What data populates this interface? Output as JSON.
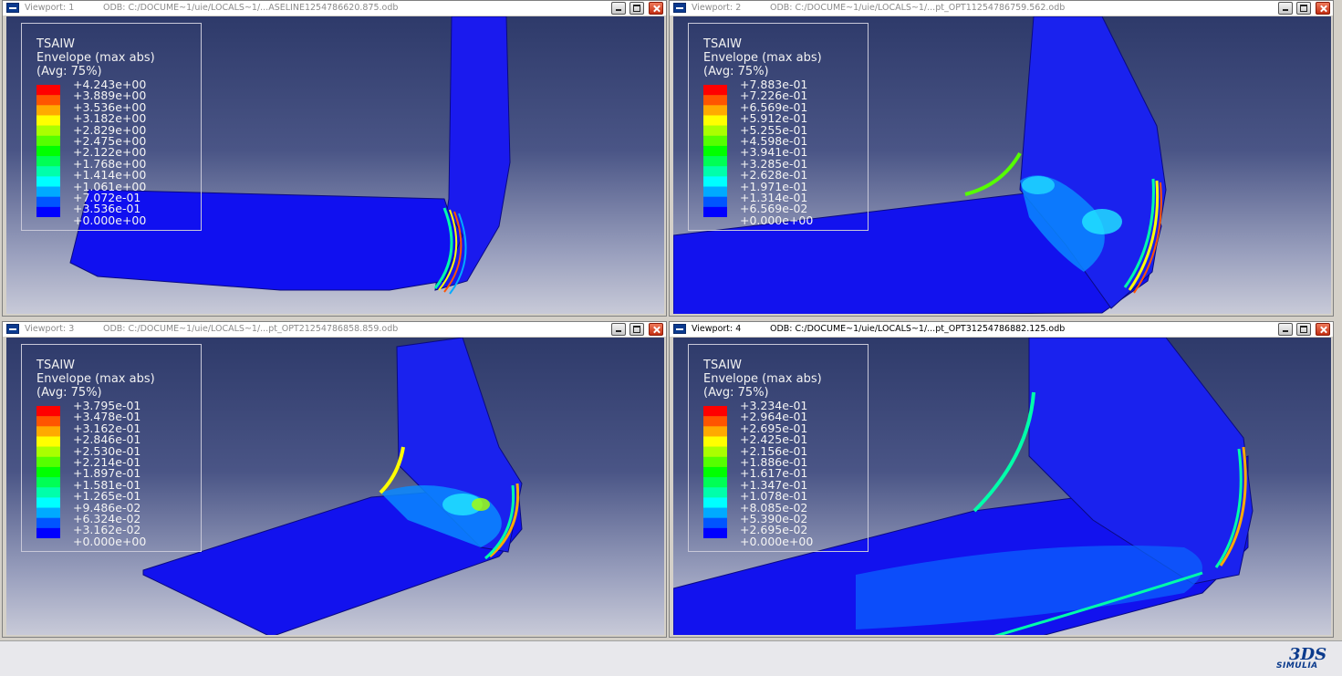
{
  "palette": [
    "#ff0000",
    "#ff5500",
    "#ffaa00",
    "#ffff00",
    "#aaff00",
    "#55ff00",
    "#00ff00",
    "#00ff55",
    "#00ffaa",
    "#00ffff",
    "#00aaff",
    "#0055ff",
    "#0000ff"
  ],
  "viewports": [
    {
      "name": "Viewport: 1",
      "odb": "ODB: C:/DOCUME~1/uie/LOCALS~1/...ASELINE1254786620.875.odb",
      "legend": {
        "title": "TSAIW",
        "subtitle": "Envelope (max abs)",
        "avg": "(Avg: 75%)",
        "values": [
          "+4.243e+00",
          "+3.889e+00",
          "+3.536e+00",
          "+3.182e+00",
          "+2.829e+00",
          "+2.475e+00",
          "+2.122e+00",
          "+1.768e+00",
          "+1.414e+00",
          "+1.061e+00",
          "+7.072e-01",
          "+3.536e-01",
          "+0.000e+00"
        ]
      }
    },
    {
      "name": "Viewport: 2",
      "odb": "ODB: C:/DOCUME~1/uie/LOCALS~1/...pt_OPT11254786759.562.odb",
      "legend": {
        "title": "TSAIW",
        "subtitle": "Envelope (max abs)",
        "avg": "(Avg: 75%)",
        "values": [
          "+7.883e-01",
          "+7.226e-01",
          "+6.569e-01",
          "+5.912e-01",
          "+5.255e-01",
          "+4.598e-01",
          "+3.941e-01",
          "+3.285e-01",
          "+2.628e-01",
          "+1.971e-01",
          "+1.314e-01",
          "+6.569e-02",
          "+0.000e+00"
        ]
      }
    },
    {
      "name": "Viewport: 3",
      "odb": "ODB: C:/DOCUME~1/uie/LOCALS~1/...pt_OPT21254786858.859.odb",
      "legend": {
        "title": "TSAIW",
        "subtitle": "Envelope (max abs)",
        "avg": "(Avg: 75%)",
        "values": [
          "+3.795e-01",
          "+3.478e-01",
          "+3.162e-01",
          "+2.846e-01",
          "+2.530e-01",
          "+2.214e-01",
          "+1.897e-01",
          "+1.581e-01",
          "+1.265e-01",
          "+9.486e-02",
          "+6.324e-02",
          "+3.162e-02",
          "+0.000e+00"
        ]
      }
    },
    {
      "name": "Viewport: 4",
      "odb": "ODB: C:/DOCUME~1/uie/LOCALS~1/...pt_OPT31254786882.125.odb",
      "legend": {
        "title": "TSAIW",
        "subtitle": "Envelope (max abs)",
        "avg": "(Avg: 75%)",
        "values": [
          "+3.234e-01",
          "+2.964e-01",
          "+2.695e-01",
          "+2.425e-01",
          "+2.156e-01",
          "+1.886e-01",
          "+1.617e-01",
          "+1.347e-01",
          "+1.078e-01",
          "+8.085e-02",
          "+5.390e-02",
          "+2.695e-02",
          "+0.000e+00"
        ]
      }
    }
  ],
  "statusbar": {
    "brand_logo": "3DS",
    "brand_name": "SIMULIA"
  }
}
